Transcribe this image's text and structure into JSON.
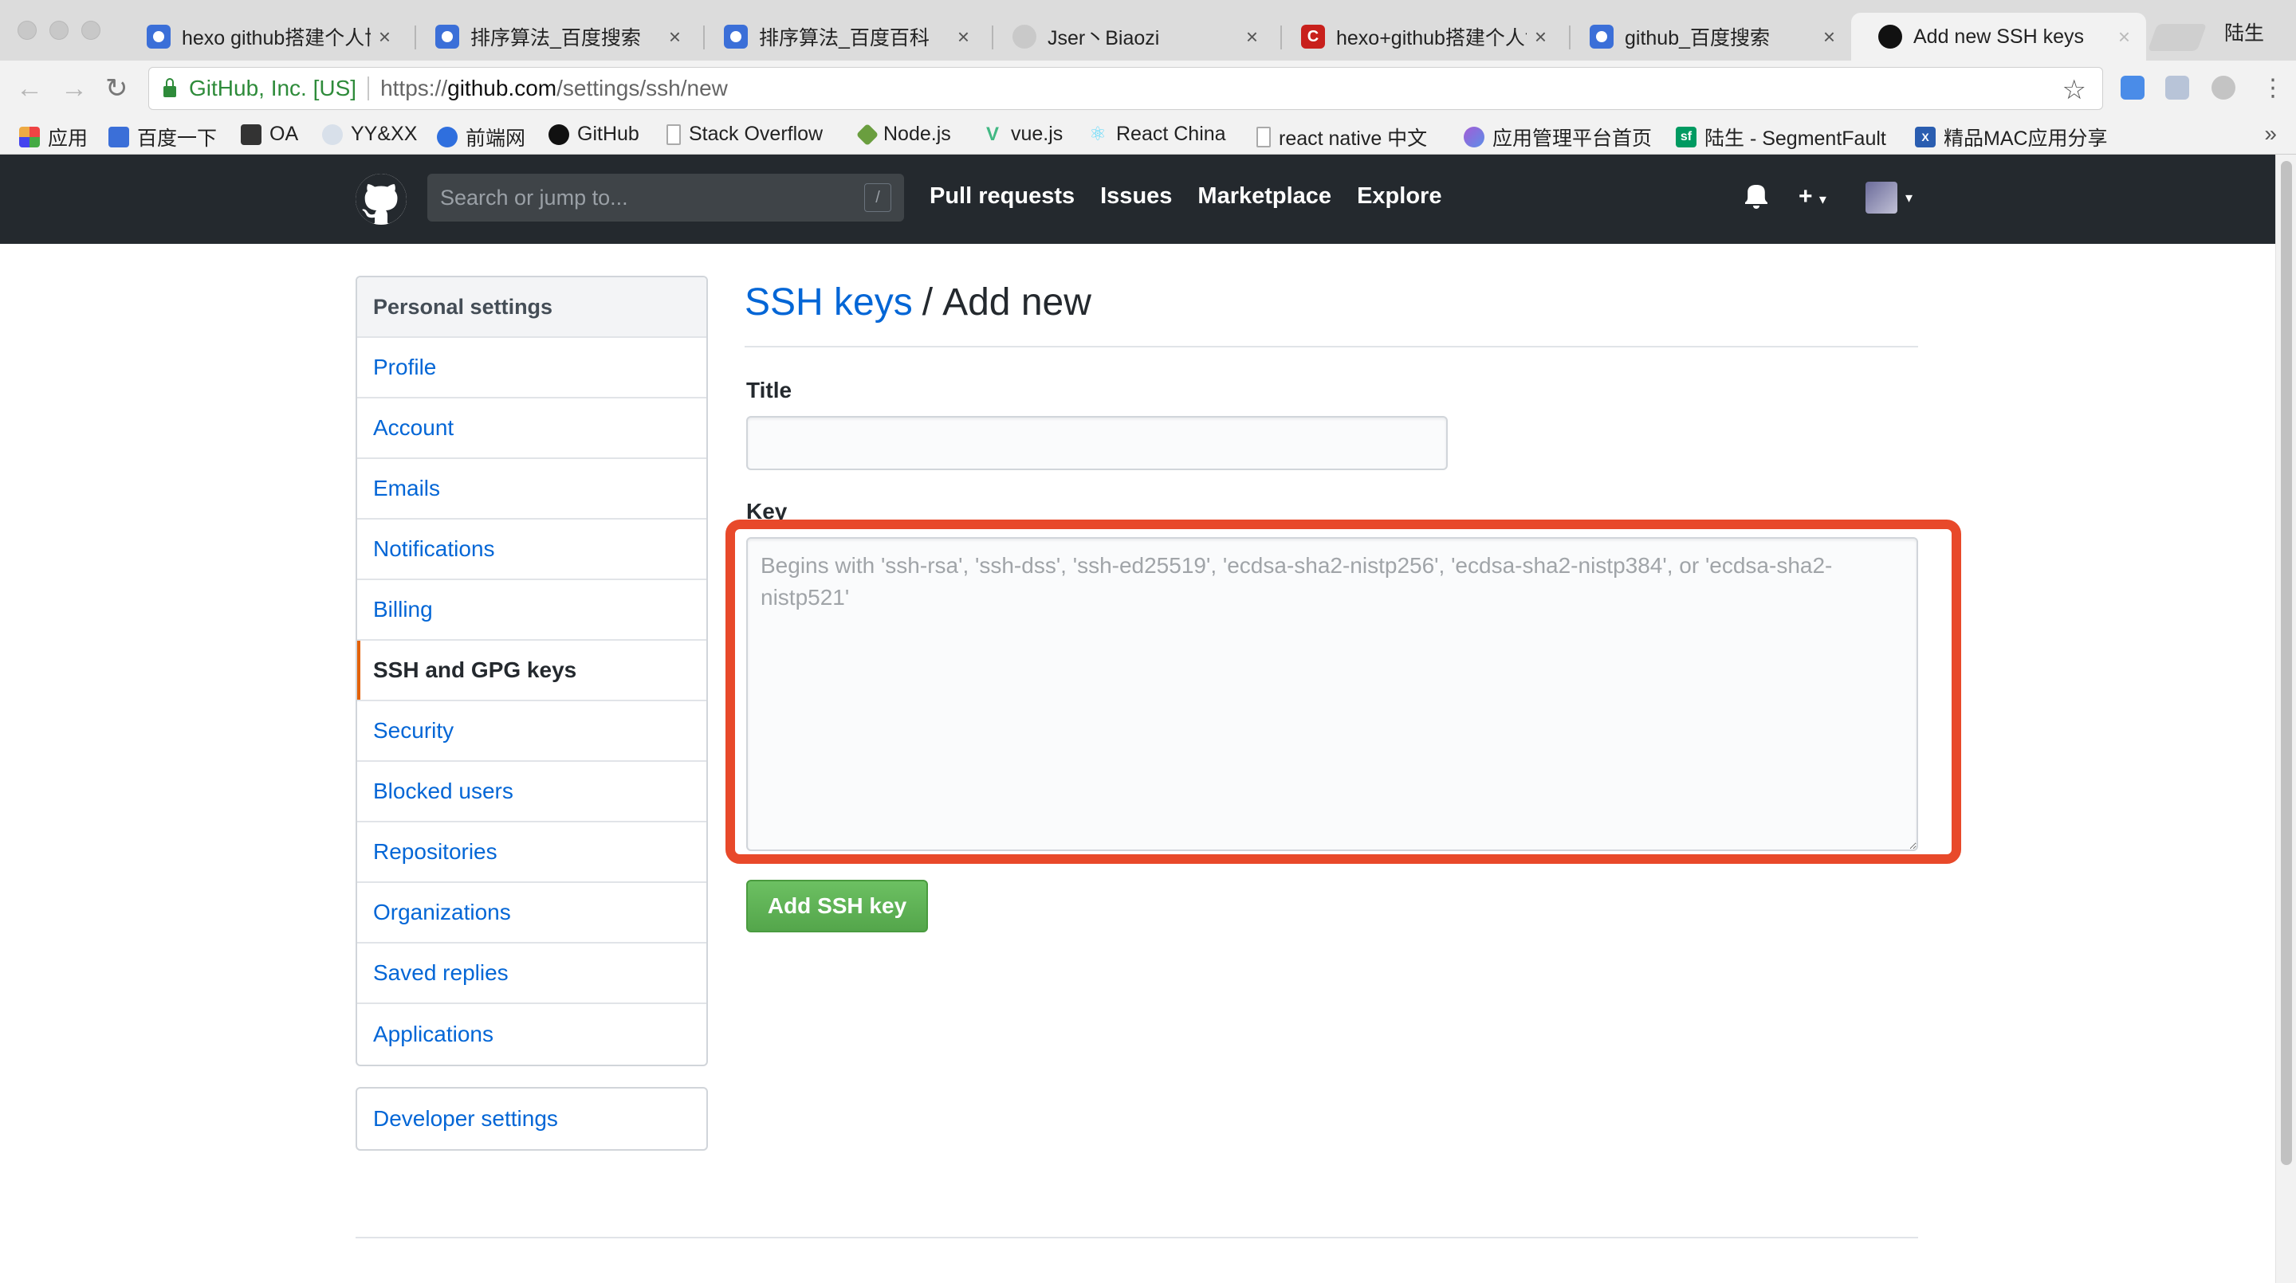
{
  "browser": {
    "tabs": [
      {
        "title": "hexo github搭建个人博",
        "favicon": "baidu-icon",
        "active": false
      },
      {
        "title": "排序算法_百度搜索",
        "favicon": "baidu-icon",
        "active": false
      },
      {
        "title": "排序算法_百度百科",
        "favicon": "baidu-icon",
        "active": false
      },
      {
        "title": "Jser丶Biaozi",
        "favicon": "globe-icon",
        "active": false
      },
      {
        "title": "hexo+github搭建个人博",
        "favicon": "csdn-icon",
        "active": false
      },
      {
        "title": "github_百度搜索",
        "favicon": "baidu-icon",
        "active": false
      },
      {
        "title": "Add new SSH keys",
        "favicon": "github-icon",
        "active": true
      }
    ],
    "tab_close_glyph": "×",
    "profile_name": "陆生",
    "address_bar": {
      "security_label": "GitHub, Inc. [US]",
      "url_scheme": "https://",
      "url_host": "github.com",
      "url_path": "/settings/ssh/new"
    },
    "bookmarks": [
      {
        "label": "应用",
        "icon": "apps-grid-icon"
      },
      {
        "label": "百度一下",
        "icon": "baidu-icon"
      },
      {
        "label": "OA",
        "icon": "oa-icon"
      },
      {
        "label": "YY&XX",
        "icon": "globe-icon"
      },
      {
        "label": "前端网",
        "icon": "qianduan-icon"
      },
      {
        "label": "GitHub",
        "icon": "github-icon"
      },
      {
        "label": "Stack Overflow",
        "icon": "page-icon"
      },
      {
        "label": "Node.js",
        "icon": "nodejs-icon"
      },
      {
        "label": "vue.js",
        "icon": "vue-icon"
      },
      {
        "label": "React China",
        "icon": "react-icon"
      },
      {
        "label": "react native 中文",
        "icon": "page-icon"
      },
      {
        "label": "应用管理平台首页",
        "icon": "app-platform-icon"
      },
      {
        "label": "陆生 - SegmentFault",
        "icon": "segmentfault-icon"
      },
      {
        "label": "精品MAC应用分享",
        "icon": "mac-app-icon"
      }
    ]
  },
  "github_header": {
    "search_placeholder": "Search or jump to...",
    "search_shortcut": "/",
    "nav": [
      "Pull requests",
      "Issues",
      "Marketplace",
      "Explore"
    ],
    "plus_label": "+"
  },
  "sidebar": {
    "heading": "Personal settings",
    "items": [
      {
        "label": "Profile",
        "selected": false
      },
      {
        "label": "Account",
        "selected": false
      },
      {
        "label": "Emails",
        "selected": false
      },
      {
        "label": "Notifications",
        "selected": false
      },
      {
        "label": "Billing",
        "selected": false
      },
      {
        "label": "SSH and GPG keys",
        "selected": true
      },
      {
        "label": "Security",
        "selected": false
      },
      {
        "label": "Blocked users",
        "selected": false
      },
      {
        "label": "Repositories",
        "selected": false
      },
      {
        "label": "Organizations",
        "selected": false
      },
      {
        "label": "Saved replies",
        "selected": false
      },
      {
        "label": "Applications",
        "selected": false
      }
    ],
    "developer_settings": "Developer settings"
  },
  "main": {
    "breadcrumb_link": "SSH keys",
    "breadcrumb_separator": "/",
    "breadcrumb_current": "Add new",
    "title_label": "Title",
    "title_value": "",
    "key_label": "Key",
    "key_value": "",
    "key_placeholder": "Begins with 'ssh-rsa', 'ssh-dss', 'ssh-ed25519', 'ecdsa-sha2-nistp256', 'ecdsa-sha2-nistp384', or 'ecdsa-sha2-nistp521'",
    "submit_label": "Add SSH key"
  },
  "colors": {
    "annotation_highlight": "#e8492a",
    "link": "#0366d6",
    "header_bg": "#24292e",
    "button_green": "#5cb354",
    "selected_accent": "#e36209"
  }
}
